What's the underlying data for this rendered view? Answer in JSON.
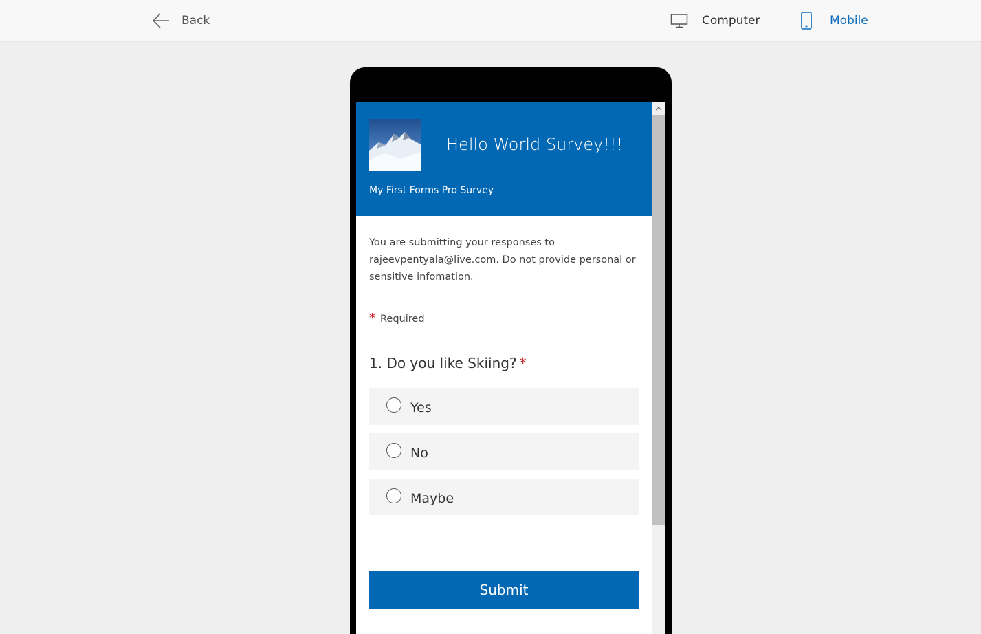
{
  "topbar": {
    "back_label": "Back",
    "computer_label": "Computer",
    "mobile_label": "Mobile",
    "active_view": "mobile"
  },
  "colors": {
    "accent": "#0368b3",
    "active_link": "#0f6cbd",
    "required_star": "#c4262e"
  },
  "icons": {
    "back": "arrow-left-icon",
    "computer": "monitor-icon",
    "mobile": "phone-icon",
    "scroll_up": "chevron-up-icon"
  },
  "form": {
    "title": "Hello World Survey!!!",
    "subtitle": "My First Forms Pro Survey",
    "notice": "You are submitting your responses to rajeevpentyala@live.com. Do not provide personal or sensitive infomation.",
    "required_star": "*",
    "required_label": "Required",
    "question": {
      "text": "1. Do you like Skiing?",
      "star": "*",
      "options": [
        "Yes",
        "No",
        "Maybe"
      ]
    },
    "submit_label": "Submit"
  }
}
